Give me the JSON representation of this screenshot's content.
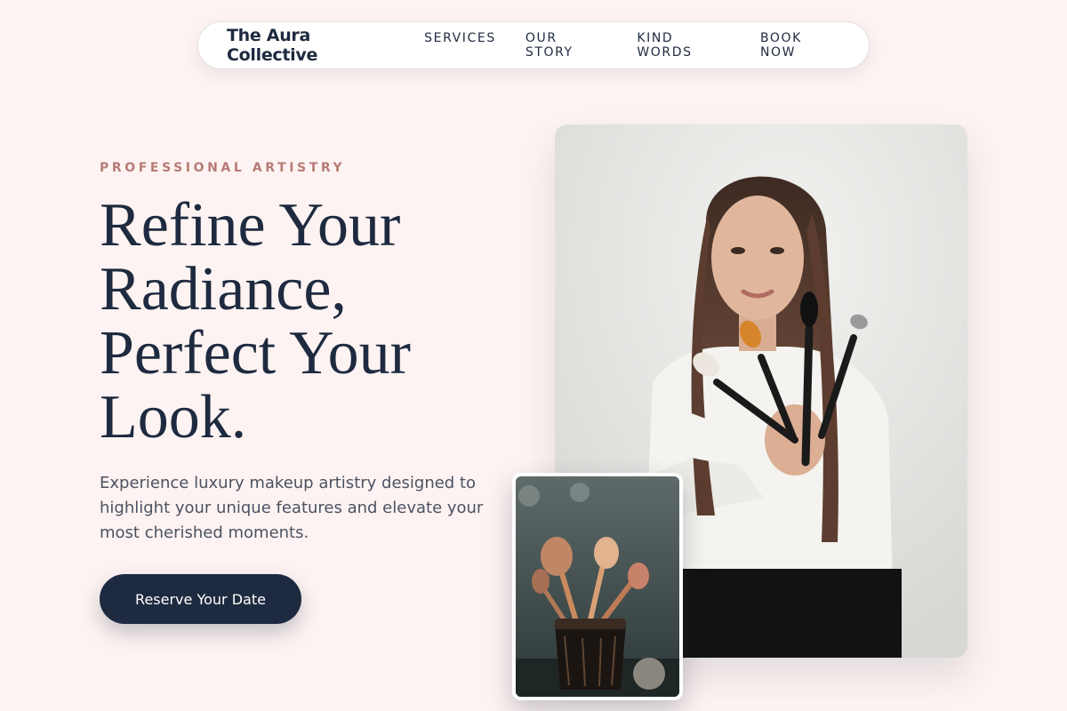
{
  "nav": {
    "brand": "The Aura Collective",
    "links": [
      "SERVICES",
      "OUR STORY",
      "KIND WORDS",
      "BOOK NOW"
    ]
  },
  "hero": {
    "eyebrow": "PROFESSIONAL ARTISTRY",
    "headline_lines": [
      "Refine Your",
      "Radiance,",
      "Perfect Your",
      "Look."
    ],
    "lede": "Experience luxury makeup artistry designed to highlight your unique features and elevate your most cherished moments.",
    "cta": "Reserve Your Date"
  },
  "colors": {
    "background": "#fdf3f2",
    "navy": "#1e2a3f",
    "accent": "#b77c76",
    "body_text": "#4b5262"
  },
  "images": {
    "main": "makeup-artist-holding-brushes",
    "detail": "brush-holder-closeup"
  }
}
